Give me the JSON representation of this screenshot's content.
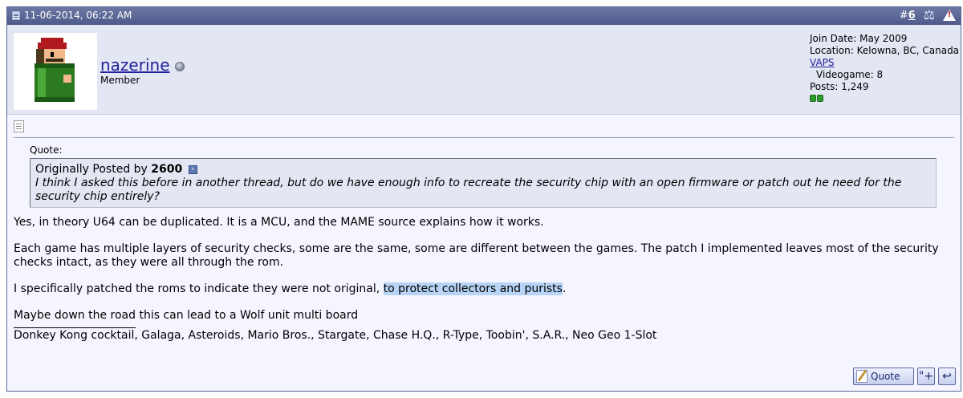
{
  "header": {
    "date": "11-06-2014, 06:22 AM",
    "post_number_prefix": "#",
    "post_number": "6"
  },
  "user": {
    "username": "nazerine",
    "title": "Member",
    "join_date": "Join Date: May 2009",
    "location": "Location: Kelowna, BC, Canada",
    "group_link": "VAPS",
    "videogame": "Videogame: 8",
    "posts": "Posts: 1,249"
  },
  "quote": {
    "label": "Quote:",
    "posted_by_prefix": "Originally Posted by",
    "author": "2600",
    "text": "I think I asked this before in another thread, but do we have enough info to recreate the security chip with an open firmware or patch out he need for the security chip entirely?"
  },
  "message": {
    "p1": "Yes, in theory U64 can be duplicated. It is a MCU, and the MAME source explains how it works.",
    "p2": "Each game has multiple layers of security checks, some are the same, some are different between the games. The patch I implemented leaves most of the security checks intact, as they were all through the rom.",
    "p3_before": "I specifically patched the roms to indicate they were not original, ",
    "p3_highlight": "to protect collectors and purists",
    "p3_after": ".",
    "p4": "Maybe down the road this can lead to a Wolf unit multi board",
    "signature": "Donkey Kong cocktail, Galaga, Asteroids, Mario Bros., Stargate, Chase H.Q., R-Type, Toobin', S.A.R., Neo Geo 1-Slot"
  },
  "buttons": {
    "quote_label": "Quote",
    "multiquote_label": "\"+",
    "quick_reply_label": "↩"
  },
  "icons": {
    "date": "post-doc-icon",
    "reputation": "scale-icon",
    "report": "warning-icon",
    "status": "offline-status-icon",
    "post_icon": "document-icon"
  }
}
